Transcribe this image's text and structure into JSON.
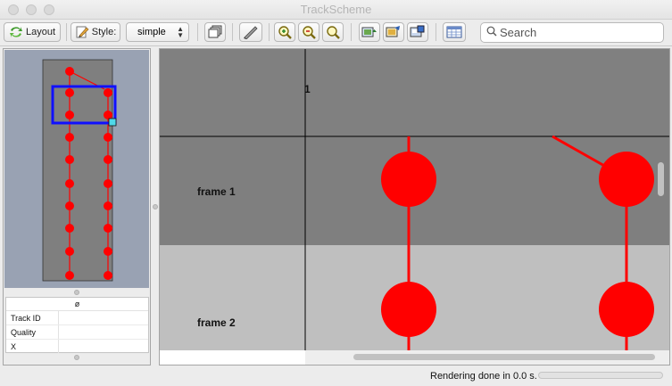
{
  "window": {
    "title": "TrackScheme"
  },
  "toolbar": {
    "layout_label": "Layout",
    "style_label": "Style:",
    "style_select_value": "simple",
    "search_placeholder": "Search"
  },
  "graph": {
    "columns": [
      "1"
    ],
    "rows": [
      "frame 1",
      "frame 2"
    ]
  },
  "info_panel": {
    "header": "ø",
    "rows": [
      {
        "label": "Track ID",
        "value": ""
      },
      {
        "label": "Quality",
        "value": ""
      },
      {
        "label": "X",
        "value": ""
      }
    ]
  },
  "status": {
    "message": "Rendering done in 0.0 s.",
    "progress": 0
  },
  "colors": {
    "spot": "#ff0000",
    "viewport": "#1010ff",
    "row_odd": "#7f7f7f",
    "row_even": "#bfbfbf",
    "header_bg": "#808080"
  }
}
